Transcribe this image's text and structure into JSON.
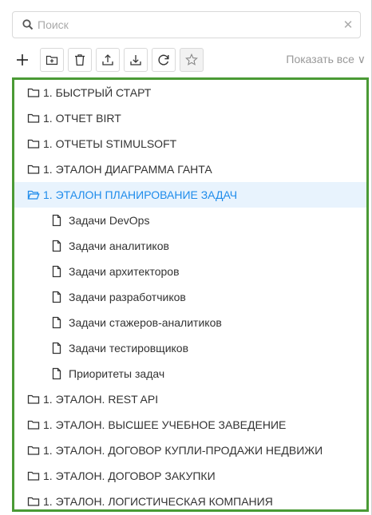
{
  "search": {
    "placeholder": "Поиск",
    "value": "",
    "clear_symbol": "✕"
  },
  "toolbar": {
    "buttons": [
      {
        "name": "add-icon"
      },
      {
        "name": "add-folder-icon"
      },
      {
        "name": "delete-icon"
      },
      {
        "name": "upload-icon"
      },
      {
        "name": "download-icon"
      },
      {
        "name": "refresh-icon"
      },
      {
        "name": "star-icon"
      }
    ],
    "show_all_label": "Показать все ∨"
  },
  "tree": {
    "accent_color": "#1f8ceb",
    "border_color": "#4a9a35",
    "items": [
      {
        "type": "folder",
        "label": "1. БЫСТРЫЙ СТАРТ"
      },
      {
        "type": "folder",
        "label": "1. ОТЧЕТ BIRT"
      },
      {
        "type": "folder",
        "label": "1. ОТЧЕТЫ STIMULSOFT"
      },
      {
        "type": "folder",
        "label": "1. ЭТАЛОН ДИАГРАММА ГАНТА"
      },
      {
        "type": "folder-open",
        "label": "1. ЭТАЛОН ПЛАНИРОВАНИЕ ЗАДАЧ",
        "selected": true,
        "expanded": true
      },
      {
        "type": "file",
        "label": "Задачи DevOps"
      },
      {
        "type": "file",
        "label": "Задачи аналитиков"
      },
      {
        "type": "file",
        "label": "Задачи архитекторов"
      },
      {
        "type": "file",
        "label": "Задачи разработчиков"
      },
      {
        "type": "file",
        "label": "Задачи стажеров-аналитиков"
      },
      {
        "type": "file",
        "label": "Задачи тестировщиков"
      },
      {
        "type": "file",
        "label": "Приоритеты задач"
      },
      {
        "type": "folder",
        "label": "1. ЭТАЛОН. REST API"
      },
      {
        "type": "folder",
        "label": "1. ЭТАЛОН. ВЫСШЕЕ УЧЕБНОЕ ЗАВЕДЕНИЕ"
      },
      {
        "type": "folder",
        "label": "1. ЭТАЛОН. ДОГОВОР КУПЛИ-ПРОДАЖИ НЕДВИЖИ"
      },
      {
        "type": "folder",
        "label": "1. ЭТАЛОН. ДОГОВОР ЗАКУПКИ"
      },
      {
        "type": "folder",
        "label": "1. ЭТАЛОН. ЛОГИСТИЧЕСКАЯ КОМПАНИЯ"
      }
    ]
  }
}
